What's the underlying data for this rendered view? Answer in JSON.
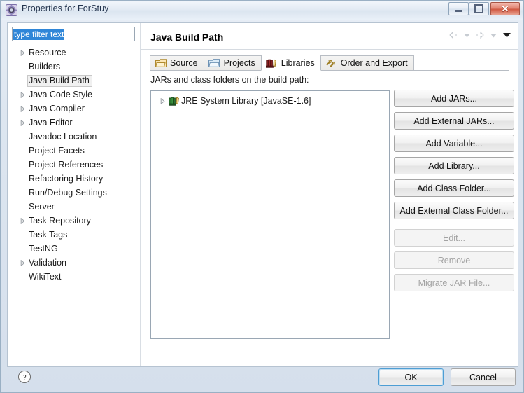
{
  "window": {
    "title": "Properties for ForStuy",
    "app_icon": "properties-gear-icon",
    "controls": {
      "minimize": "minimize-button",
      "maximize": "maximize-button",
      "close": "close-button",
      "close_glyph": "✕"
    }
  },
  "sidebar": {
    "filter": {
      "value": "type filter text",
      "placeholder": "type filter text",
      "selected": true,
      "selection_color": "#2f86d8"
    },
    "items": [
      {
        "label": "Resource",
        "expandable": true,
        "selected": false
      },
      {
        "label": "Builders",
        "expandable": false,
        "selected": false
      },
      {
        "label": "Java Build Path",
        "expandable": false,
        "selected": true
      },
      {
        "label": "Java Code Style",
        "expandable": true,
        "selected": false
      },
      {
        "label": "Java Compiler",
        "expandable": true,
        "selected": false
      },
      {
        "label": "Java Editor",
        "expandable": true,
        "selected": false
      },
      {
        "label": "Javadoc Location",
        "expandable": false,
        "selected": false
      },
      {
        "label": "Project Facets",
        "expandable": false,
        "selected": false
      },
      {
        "label": "Project References",
        "expandable": false,
        "selected": false
      },
      {
        "label": "Refactoring History",
        "expandable": false,
        "selected": false
      },
      {
        "label": "Run/Debug Settings",
        "expandable": false,
        "selected": false
      },
      {
        "label": "Server",
        "expandable": false,
        "selected": false
      },
      {
        "label": "Task Repository",
        "expandable": true,
        "selected": false
      },
      {
        "label": "Task Tags",
        "expandable": false,
        "selected": false
      },
      {
        "label": "TestNG",
        "expandable": false,
        "selected": false
      },
      {
        "label": "Validation",
        "expandable": true,
        "selected": false
      },
      {
        "label": "WikiText",
        "expandable": false,
        "selected": false
      }
    ]
  },
  "page": {
    "title": "Java Build Path",
    "nav": [
      {
        "name": "back-arrow-icon",
        "enabled": false
      },
      {
        "name": "back-dropdown-icon",
        "enabled": false
      },
      {
        "name": "forward-arrow-icon",
        "enabled": false
      },
      {
        "name": "forward-dropdown-icon",
        "enabled": false
      },
      {
        "name": "view-menu-chevron-icon",
        "enabled": true
      }
    ]
  },
  "tabs": [
    {
      "label": "Source",
      "icon": "source-folder-icon",
      "active": false
    },
    {
      "label": "Projects",
      "icon": "projects-folder-icon",
      "active": false
    },
    {
      "label": "Libraries",
      "icon": "libraries-books-icon",
      "active": true
    },
    {
      "label": "Order and Export",
      "icon": "order-export-icon",
      "active": false
    }
  ],
  "libraries": {
    "caption": "JARs and class folders on the build path:",
    "entries": [
      {
        "label": "JRE System Library [JavaSE-1.6]",
        "icon": "jre-library-icon",
        "expandable": true
      }
    ],
    "buttons": [
      {
        "label": "Add JARs...",
        "enabled": true
      },
      {
        "label": "Add External JARs...",
        "enabled": true
      },
      {
        "label": "Add Variable...",
        "enabled": true
      },
      {
        "label": "Add Library...",
        "enabled": true
      },
      {
        "label": "Add Class Folder...",
        "enabled": true
      },
      {
        "label": "Add External Class Folder...",
        "enabled": true
      },
      {
        "label": "Edit...",
        "enabled": false
      },
      {
        "label": "Remove",
        "enabled": false
      },
      {
        "label": "Migrate JAR File...",
        "enabled": false
      }
    ]
  },
  "footer": {
    "help_icon": "help-question-icon",
    "ok_label": "OK",
    "cancel_label": "Cancel",
    "default_button": "OK",
    "focus_color": "#4e9ed4"
  }
}
